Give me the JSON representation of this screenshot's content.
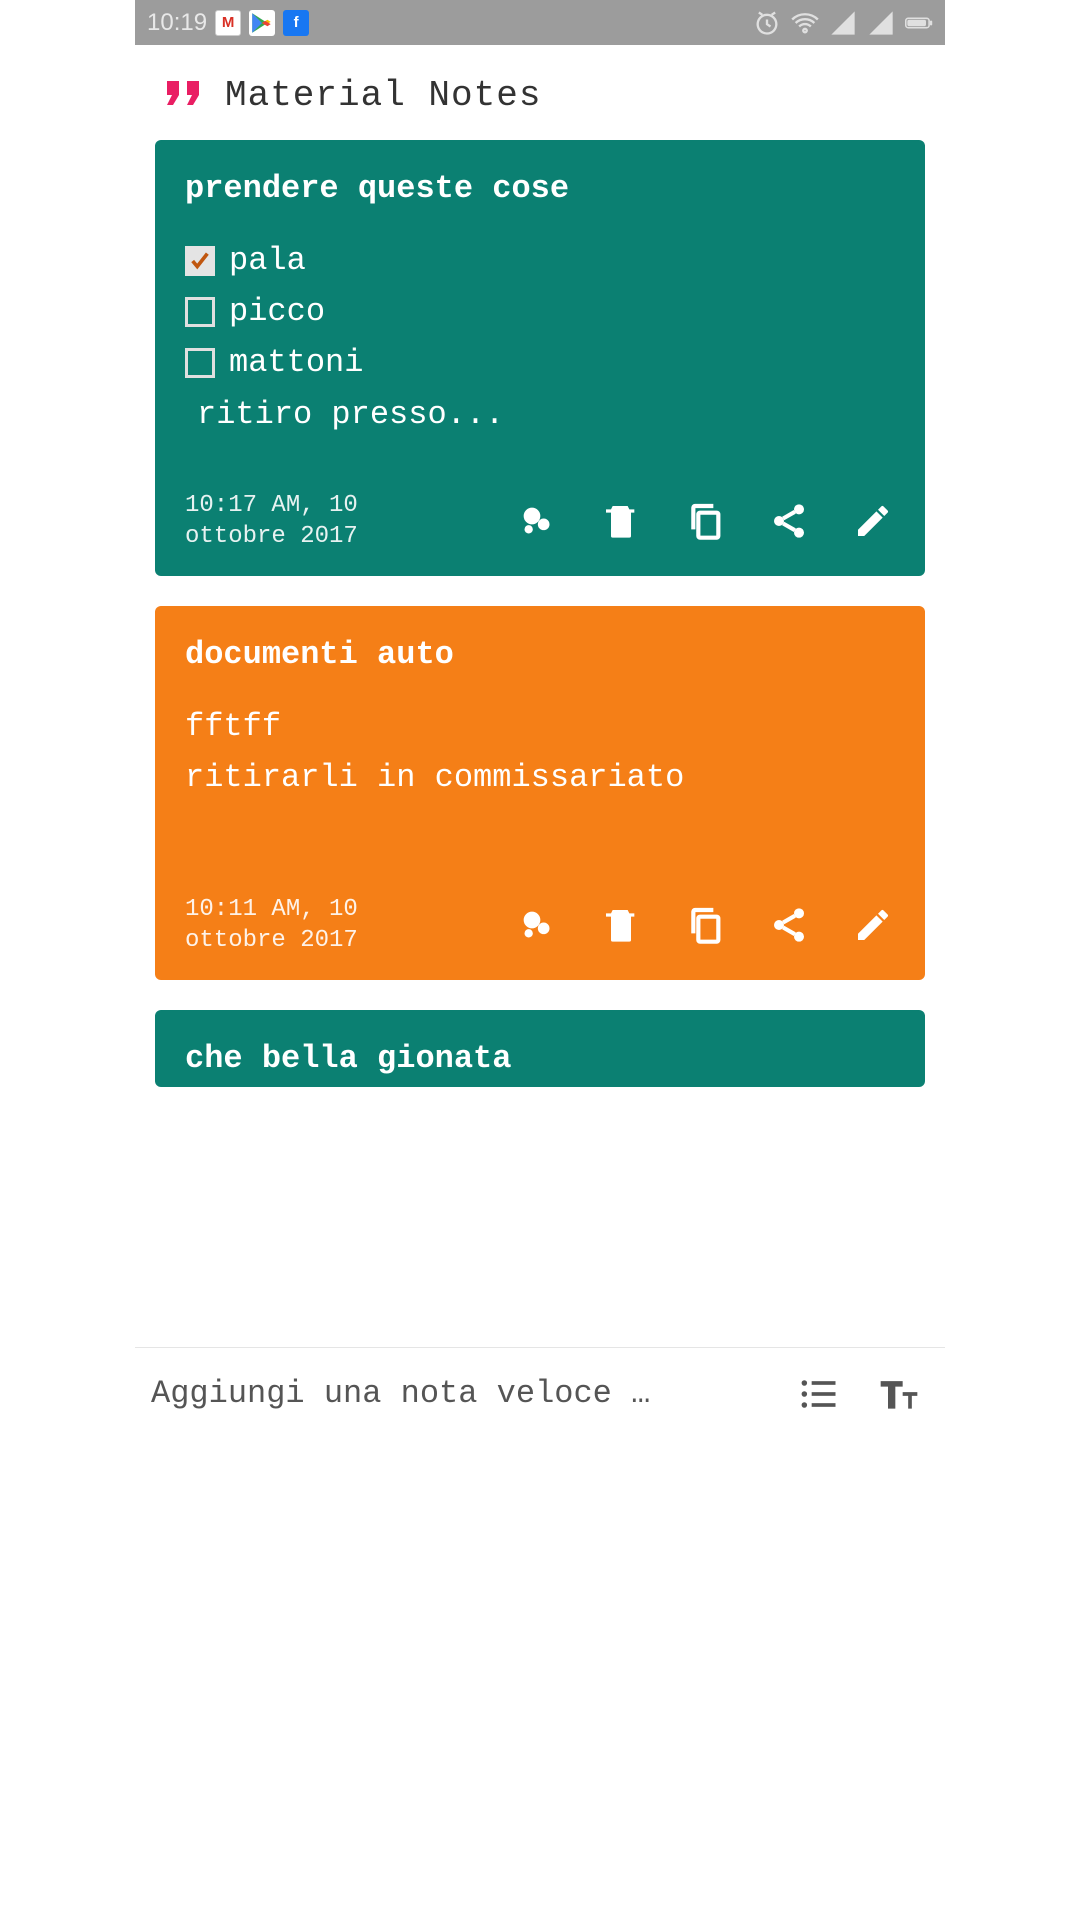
{
  "statusBar": {
    "time": "10:19"
  },
  "header": {
    "title": "Material Notes"
  },
  "notes": [
    {
      "title": "prendere queste cose",
      "color": "#0b8072",
      "items": [
        {
          "text": "pala",
          "checked": true
        },
        {
          "text": "picco",
          "checked": false
        },
        {
          "text": "mattoni",
          "checked": false
        }
      ],
      "extraText": "ritiro presso...",
      "timestamp": "10:17 AM, 10 ottobre 2017"
    },
    {
      "title": "documenti auto",
      "color": "#f57f17",
      "lines": [
        "fftff",
        "ritirarli in commissariato"
      ],
      "timestamp": "10:11 AM, 10 ottobre 2017"
    },
    {
      "title": "che bella gionata",
      "color": "#0b8072"
    }
  ],
  "bottomBar": {
    "placeholder": "Aggiungi una nota veloce …"
  }
}
